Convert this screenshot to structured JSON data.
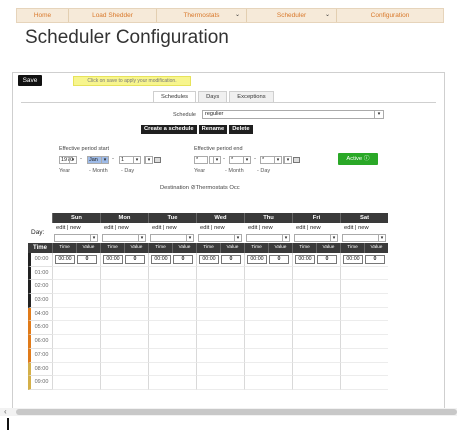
{
  "nav": {
    "items": [
      {
        "label": "Home",
        "caret": false
      },
      {
        "label": "Load Shedder",
        "caret": false
      },
      {
        "label": "Thermostats",
        "caret": true
      },
      {
        "label": "Scheduler",
        "caret": true
      },
      {
        "label": "Configuration",
        "caret": false
      }
    ],
    "caret_glyph": "⌄"
  },
  "page_title": "Scheduler Configuration",
  "toolbar": {
    "save_label": "Save",
    "hint": "Click on save to apply your modification."
  },
  "tabs": [
    "Schedules",
    "Days",
    "Exceptions"
  ],
  "schedule": {
    "label": "Schedule",
    "selected": "regulier",
    "buttons": [
      "Create a schedule",
      "Rename",
      "Delete"
    ]
  },
  "period_start": {
    "label": "Effective period start",
    "year": "1970",
    "month": "Jan",
    "day": "1",
    "sub_labels": {
      "year": "Year",
      "month": "- Month",
      "day": "- Day"
    }
  },
  "period_end": {
    "label": "Effective period end",
    "year": "*",
    "month": "*",
    "day": "*",
    "sub_labels": {
      "year": "Year",
      "month": "- Month",
      "day": "- Day"
    }
  },
  "dash": "-",
  "active": {
    "label": "Active",
    "icon": "info-icon"
  },
  "destination": {
    "label": "Destination",
    "value": "Thermostats Occ"
  },
  "grid": {
    "day_label": "Day:",
    "days": [
      "Sun",
      "Mon",
      "Tue",
      "Wed",
      "Thu",
      "Fri",
      "Sat"
    ],
    "edit_new": "edit | new",
    "time_header": "Time",
    "col_time": "Time",
    "col_value": "Value",
    "first_row": {
      "time": "00:00",
      "value": "0"
    },
    "hours": [
      "00:00",
      "01:00",
      "02:00",
      "03:00",
      "04:00",
      "05:00",
      "06:00",
      "07:00",
      "08:00",
      "09:00"
    ],
    "hour_marker_colors": [
      "#222222",
      "#222222",
      "#222222",
      "#222222",
      "#e07b1a",
      "#e07b1a",
      "#e07b1a",
      "#e07b1a",
      "#d4b04a",
      "#d4b04a"
    ]
  },
  "scrollbar": {
    "arrow": "‹"
  }
}
